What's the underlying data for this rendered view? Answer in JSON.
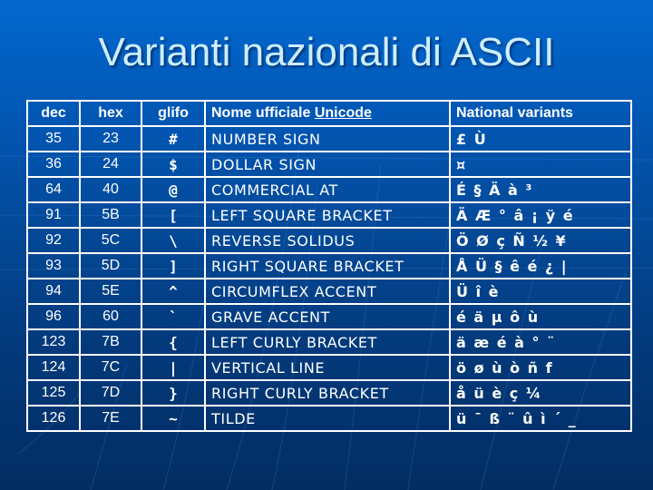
{
  "slide": {
    "title": "Varianti nazionali di ASCII"
  },
  "colors": {
    "background_top": "#0368cf",
    "background_bottom": "#022d62",
    "title_text": "#cdeefe",
    "table_text": "#ffffff",
    "table_border": "#ffffff"
  },
  "table": {
    "headers": {
      "dec": "dec",
      "hex": "hex",
      "glyph": "glifo",
      "name_prefix": "Nome ufficiale ",
      "name_link": "Unicode",
      "national": "National variants"
    },
    "rows": [
      {
        "dec": "35",
        "hex": "23",
        "glyph": "#",
        "name": "NUMBER SIGN",
        "national": "£ Ù"
      },
      {
        "dec": "36",
        "hex": "24",
        "glyph": "$",
        "name": "DOLLAR SIGN",
        "national": "¤"
      },
      {
        "dec": "64",
        "hex": "40",
        "glyph": "@",
        "name": "COMMERCIAL AT",
        "national": "É § Ä à ³"
      },
      {
        "dec": "91",
        "hex": "5B",
        "glyph": "[",
        "name": "LEFT SQUARE BRACKET",
        "national": "Ä Æ ° â ¡ ÿ é"
      },
      {
        "dec": "92",
        "hex": "5C",
        "glyph": "\\",
        "name": "REVERSE SOLIDUS",
        "national": "Ö Ø ç Ñ ½ ¥"
      },
      {
        "dec": "93",
        "hex": "5D",
        "glyph": "]",
        "name": "RIGHT SQUARE BRACKET",
        "national": "Å Ü § ê é ¿ |"
      },
      {
        "dec": "94",
        "hex": "5E",
        "glyph": "^",
        "name": "CIRCUMFLEX ACCENT",
        "national": "Ü î è"
      },
      {
        "dec": "96",
        "hex": "60",
        "glyph": "`",
        "name": "GRAVE ACCENT",
        "national": "é ä µ ô ù"
      },
      {
        "dec": "123",
        "hex": "7B",
        "glyph": "{",
        "name": "LEFT CURLY BRACKET",
        "national": "ä æ é à ° ¨"
      },
      {
        "dec": "124",
        "hex": "7C",
        "glyph": "|",
        "name": "VERTICAL LINE",
        "national": "ö ø ù ò ñ f"
      },
      {
        "dec": "125",
        "hex": "7D",
        "glyph": "}",
        "name": "RIGHT CURLY BRACKET",
        "national": "å ü è ç ¼"
      },
      {
        "dec": "126",
        "hex": "7E",
        "glyph": "~",
        "name": "TILDE",
        "national": "ü ¯ ß ¨ û ì ´ _"
      }
    ]
  }
}
